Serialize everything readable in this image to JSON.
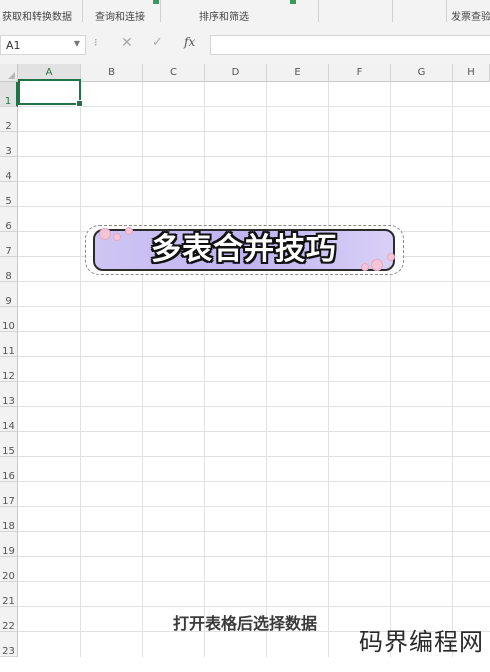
{
  "ribbon": {
    "groups": [
      "获取和转换数据",
      "查询和连接",
      "排序和筛选",
      "发票查验"
    ]
  },
  "formula_bar": {
    "name_box": "A1",
    "name_box_arrow": "▼",
    "dots": "⁝",
    "cancel_icon": "✕",
    "enter_icon": "✓",
    "fx_label": "fx",
    "formula_value": ""
  },
  "sheet": {
    "columns": [
      "A",
      "B",
      "C",
      "D",
      "E",
      "F",
      "G",
      "H"
    ],
    "rows": [
      "1",
      "2",
      "3",
      "4",
      "5",
      "6",
      "7",
      "8",
      "9",
      "10",
      "11",
      "12",
      "13",
      "14",
      "15",
      "16",
      "17",
      "18",
      "19",
      "20",
      "21",
      "22",
      "23"
    ],
    "selected_cell": "A1"
  },
  "overlay": {
    "title": "多表合并技巧",
    "caption": "打开表格后选择数据",
    "watermark": "码界编程网"
  }
}
